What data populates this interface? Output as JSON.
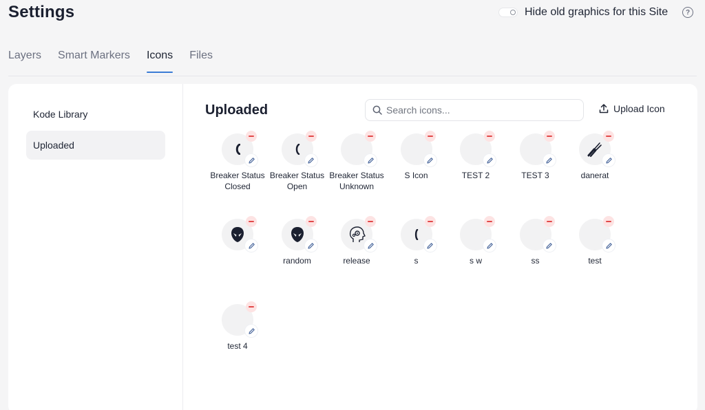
{
  "header": {
    "title": "Settings",
    "toggle_label": "Hide old graphics for this Site",
    "help_icon": "question-circle-icon"
  },
  "tabs": [
    {
      "label": "Layers",
      "active": false
    },
    {
      "label": "Smart Markers",
      "active": false
    },
    {
      "label": "Icons",
      "active": true
    },
    {
      "label": "Files",
      "active": false
    }
  ],
  "sidebar": {
    "items": [
      {
        "label": "Kode Library",
        "active": false
      },
      {
        "label": "Uploaded",
        "active": true
      }
    ]
  },
  "main": {
    "section_title": "Uploaded",
    "search_placeholder": "Search icons...",
    "upload_label": "Upload Icon",
    "icons": [
      {
        "label": "Breaker Status Closed",
        "glyph": "breaker-closed-icon"
      },
      {
        "label": "Breaker Status Open",
        "glyph": "breaker-open-icon"
      },
      {
        "label": "Breaker Status Unknown",
        "glyph": "blank"
      },
      {
        "label": "S Icon",
        "glyph": "blank"
      },
      {
        "label": "TEST 2",
        "glyph": "blank"
      },
      {
        "label": "TEST 3",
        "glyph": "blank"
      },
      {
        "label": "danerat",
        "glyph": "pliers-icon"
      },
      {
        "label": "",
        "glyph": "alien-head-icon"
      },
      {
        "label": "random",
        "glyph": "alien-head-icon"
      },
      {
        "label": "release",
        "glyph": "head-gear-icon"
      },
      {
        "label": "s",
        "glyph": "sliver-icon"
      },
      {
        "label": "s w",
        "glyph": "blank"
      },
      {
        "label": "ss",
        "glyph": "blank"
      },
      {
        "label": "test",
        "glyph": "blank"
      },
      {
        "label": "test 4",
        "glyph": "blank"
      }
    ]
  }
}
